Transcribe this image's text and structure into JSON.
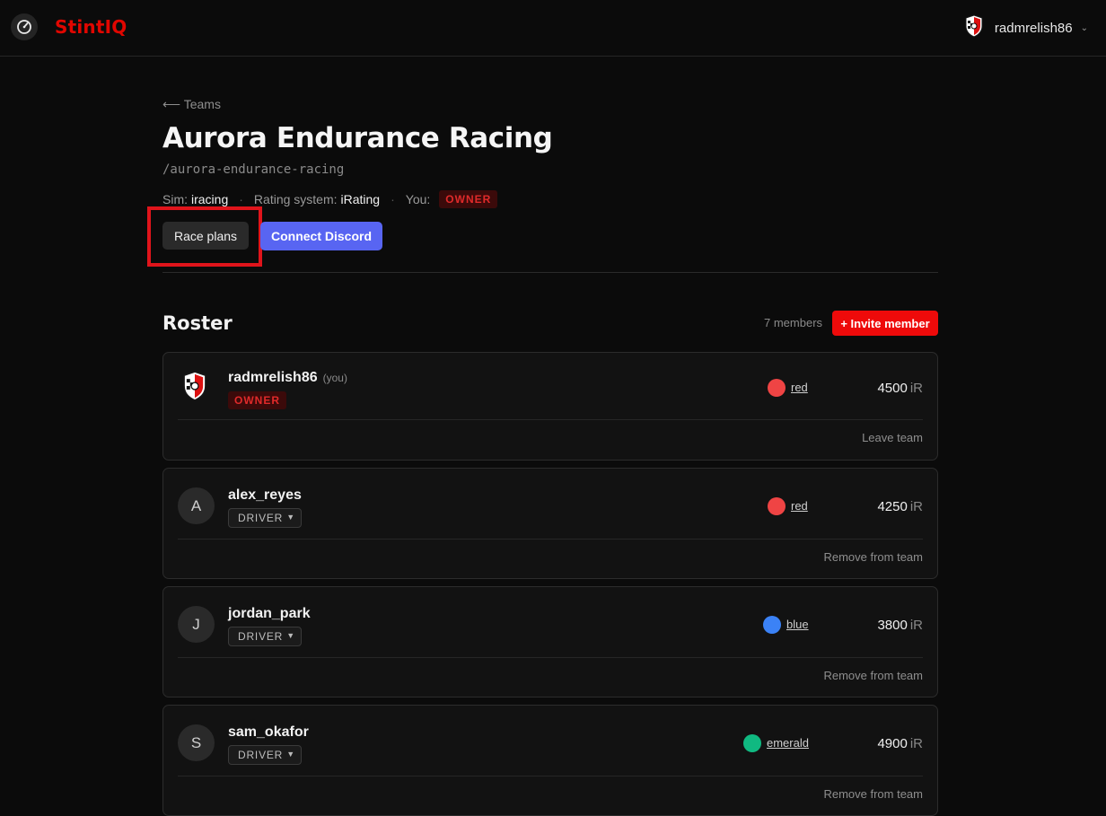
{
  "app": {
    "brand": "StintIQ"
  },
  "user": {
    "username": "radmrelish86"
  },
  "nav": {
    "back_label": "⟵ Teams"
  },
  "team": {
    "name": "Aurora Endurance Racing",
    "slug": "/aurora-endurance-racing",
    "sim_label": "Sim:",
    "sim_value": "iracing",
    "rating_label": "Rating system:",
    "rating_value": "iRating",
    "you_label": "You:",
    "you_role": "OWNER"
  },
  "actions": {
    "race_plans": "Race plans",
    "connect_discord": "Connect Discord"
  },
  "roster": {
    "title": "Roster",
    "count": "7 members",
    "invite_label": "+ Invite member",
    "rating_unit": "iR",
    "members": [
      {
        "name": "radmrelish86",
        "you_tag": "(you)",
        "role": "OWNER",
        "color": "red",
        "color_hex": "#ef4444",
        "rating": "4500",
        "action": "Leave team"
      },
      {
        "name": "alex_reyes",
        "initial": "A",
        "role": "DRIVER",
        "color": "red",
        "color_hex": "#ef4444",
        "rating": "4250",
        "action": "Remove from team"
      },
      {
        "name": "jordan_park",
        "initial": "J",
        "role": "DRIVER",
        "color": "blue",
        "color_hex": "#3b82f6",
        "rating": "3800",
        "action": "Remove from team"
      },
      {
        "name": "sam_okafor",
        "initial": "S",
        "role": "DRIVER",
        "color": "emerald",
        "color_hex": "#10b981",
        "rating": "4900",
        "action": "Remove from team"
      }
    ]
  }
}
